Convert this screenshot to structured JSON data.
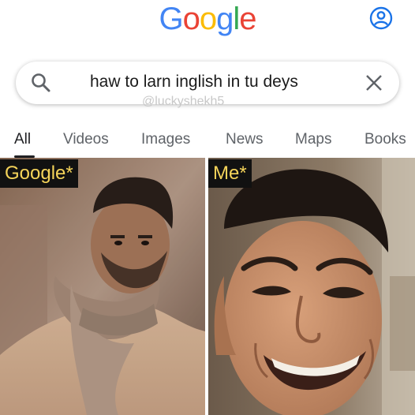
{
  "header": {
    "logo_letters": [
      "G",
      "o",
      "o",
      "g",
      "l",
      "e"
    ],
    "logo_colors": [
      "#4285F4",
      "#EA4335",
      "#FBBC05",
      "#4285F4",
      "#34A853",
      "#EA4335"
    ]
  },
  "search": {
    "query": "haw to larn inglish in tu deys",
    "watermark": "@luckyshekh5"
  },
  "tabs": [
    {
      "label": "All",
      "active": true
    },
    {
      "label": "Videos"
    },
    {
      "label": "Images"
    },
    {
      "label": "News"
    },
    {
      "label": "Maps"
    },
    {
      "label": "Books"
    }
  ],
  "panels": {
    "left_caption": "Google*",
    "right_caption": "Me*"
  }
}
